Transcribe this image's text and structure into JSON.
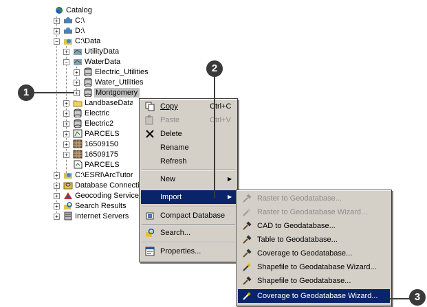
{
  "tree": {
    "catalog": "Catalog",
    "c_drive": "C:\\",
    "d_drive": "D:\\",
    "c_data": "C:\\Data",
    "utility_data": "UtilityData",
    "water_data": "WaterData",
    "electric_utilities": "Electric_Utilities",
    "water_utilities": "Water_Utilities",
    "montgomery": "Montgomery",
    "landbase": "LandbaseData",
    "electric": "Electric",
    "electric2": "Electric2",
    "parcels": "PARCELS",
    "n16509150": "16509150",
    "n16509175": "16509175",
    "parcels2": "PARCELS",
    "esri": "C:\\ESRI\\ArcTutor",
    "db_conn": "Database Connections",
    "geocoding": "Geocoding Services",
    "search_results": "Search Results",
    "internet": "Internet Servers"
  },
  "context_menu": {
    "copy": "Copy",
    "copy_key": "Ctrl+C",
    "paste": "Paste",
    "paste_key": "Ctrl+V",
    "delete": "Delete",
    "rename": "Rename",
    "refresh": "Refresh",
    "new": "New",
    "import": "Import",
    "compact": "Compact Database",
    "search": "Search...",
    "properties": "Properties..."
  },
  "import_menu": {
    "raster": "Raster to Geodatabase...",
    "raster_wizard": "Raster to Geodatabase Wizard...",
    "cad": "CAD to Geodatabase...",
    "table": "Table to Geodatabase...",
    "coverage": "Coverage to Geodatabase...",
    "shapefile_wizard": "Shapefile to Geodatabase Wizard...",
    "shapefile": "Shapefile to Geodatabase...",
    "coverage_wizard": "Coverage to Geodatabase Wizard..."
  },
  "callouts": {
    "c1": "1",
    "c2": "2",
    "c3": "3"
  },
  "colors": {
    "highlight": "#0a246a",
    "menu_bg": "#d4d0c8",
    "callout": "#3a3a3a"
  }
}
